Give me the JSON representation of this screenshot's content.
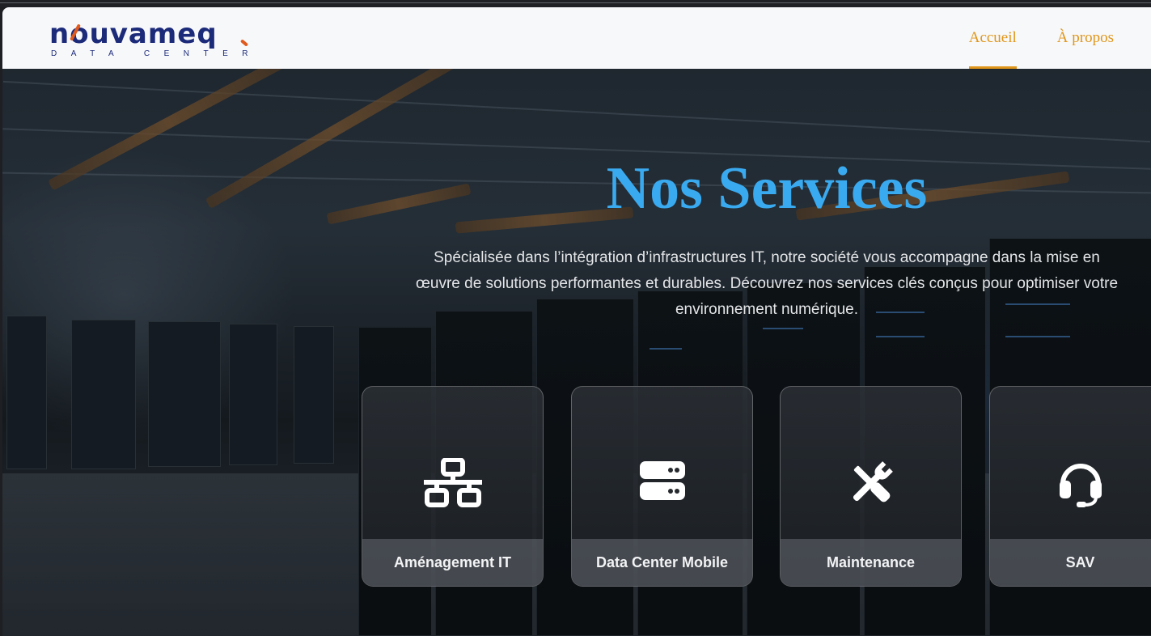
{
  "brand": {
    "name": "nouvameq",
    "tagline": "DATA CENTER",
    "accent_color": "#e0961a",
    "logo_color": "#1c2a7a"
  },
  "nav": {
    "items": [
      {
        "label": "Accueil",
        "active": true
      },
      {
        "label": "À propos",
        "active": false
      }
    ]
  },
  "hero": {
    "title": "Nos Services",
    "title_color": "#3aaaf0",
    "description": "Spécialisée dans l’intégration d’infrastructures IT, notre société vous accompagne dans la mise en œuvre de solutions performantes et durables. Découvrez nos services clés conçus pour optimiser votre environnement numérique."
  },
  "services": [
    {
      "label": "Aménagement IT",
      "icon": "network-icon"
    },
    {
      "label": "Data Center Mobile",
      "icon": "server-icon"
    },
    {
      "label": "Maintenance",
      "icon": "tools-icon"
    },
    {
      "label": "SAV",
      "icon": "headset-icon"
    }
  ]
}
